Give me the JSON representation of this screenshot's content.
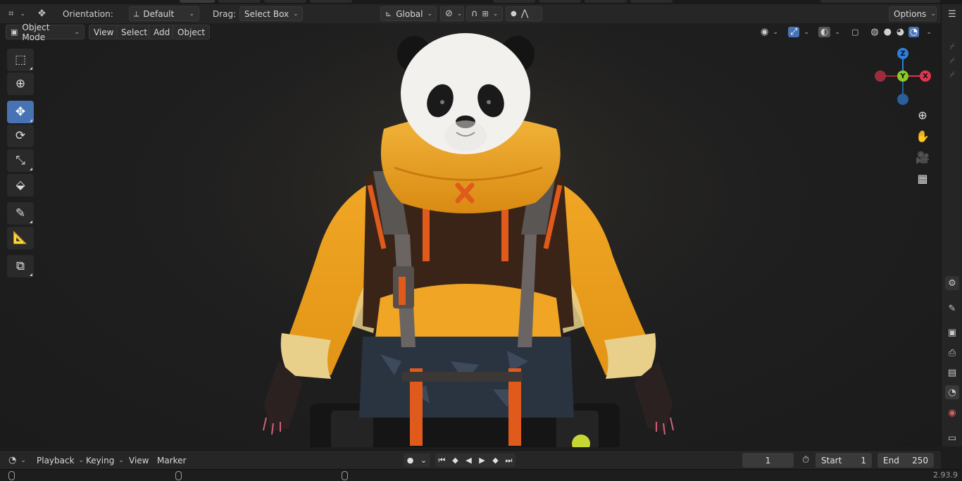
{
  "header": {
    "editor_type_icon": "3d-viewport-icon",
    "transform_icon": "move-icon",
    "orientation_label": "Orientation:",
    "orientation_value": "Default",
    "drag_label": "Drag:",
    "drag_value": "Select Box",
    "transform_space": "Global",
    "pivot_icon": "pivot-icon",
    "snap_icon": "magnet-icon",
    "snap_target_icon": "snap-increment-icon",
    "proportional_icon": "proportional-edit-icon",
    "falloff_icon": "falloff-curve-icon",
    "options_label": "Options"
  },
  "viewport_header": {
    "mode_label": "Object Mode",
    "menus": [
      "View",
      "Select",
      "Add",
      "Object"
    ],
    "visibility_icon": "eye-icon",
    "gizmo_toggle_icon": "gizmo-icon",
    "overlay_icon": "overlay-icon",
    "xray_icon": "xray-icon",
    "shading_modes": [
      "wireframe",
      "solid",
      "material-preview",
      "rendered"
    ],
    "active_shading": "rendered"
  },
  "toolbar": {
    "tools": [
      {
        "name": "select-box",
        "icon": "select-box-icon",
        "active": false
      },
      {
        "name": "cursor",
        "icon": "cursor-icon",
        "active": false
      },
      {
        "name": "move",
        "icon": "move-icon",
        "active": true
      },
      {
        "name": "rotate",
        "icon": "rotate-icon",
        "active": false
      },
      {
        "name": "scale",
        "icon": "scale-icon",
        "active": false
      },
      {
        "name": "transform",
        "icon": "transform-icon",
        "active": false
      },
      {
        "name": "annotate",
        "icon": "annotate-icon",
        "active": false
      },
      {
        "name": "measure",
        "icon": "measure-icon",
        "active": false
      },
      {
        "name": "add-cube",
        "icon": "add-cube-icon",
        "active": false
      }
    ]
  },
  "gizmo": {
    "axes": [
      {
        "label": "Z",
        "color": "#2f7ed8"
      },
      {
        "label": "Y",
        "color": "#8ac926"
      },
      {
        "label": "X",
        "color": "#e0364f"
      }
    ],
    "negative_colors": {
      "x": "#9b2c3c",
      "z": "#2a5f9c"
    }
  },
  "navigation": [
    "zoom-icon",
    "pan-hand-icon",
    "camera-icon",
    "ortho-grid-icon"
  ],
  "properties_tabs": [
    "tool-icon",
    "render-icon",
    "output-icon",
    "view-layer-icon",
    "scene-icon",
    "world-icon",
    "collection-icon",
    "object-icon"
  ],
  "timeline": {
    "menus": [
      "Playback",
      "Keying",
      "View",
      "Marker"
    ],
    "current_frame": "1",
    "start_label": "Start",
    "start_value": "1",
    "end_label": "End",
    "end_value": "250"
  },
  "status": {
    "version": "2.93.9"
  },
  "colors": {
    "accent": "#4772b3",
    "hoodie": "#e89a1a",
    "harness": "#e05a1c"
  }
}
